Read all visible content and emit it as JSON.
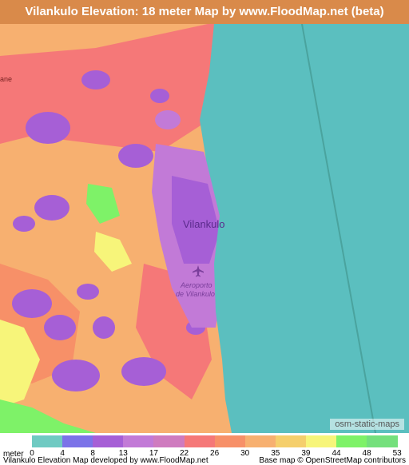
{
  "title": "Vilankulo Elevation: 18 meter Map by www.FloodMap.net (beta)",
  "map": {
    "city_label": "Vilankulo",
    "airport_label_line1": "Aeroporto",
    "airport_label_line2": "de Vilankulo",
    "edge_label": "ane",
    "attribution_badge": "osm-static-maps",
    "airport_icon": "airplane-icon",
    "sea_color": "#5bbfbf"
  },
  "legend": {
    "unit": "meter",
    "ticks": [
      "0",
      "4",
      "8",
      "13",
      "17",
      "22",
      "26",
      "30",
      "35",
      "39",
      "44",
      "48",
      "53"
    ],
    "colors": [
      "#6fcac2",
      "#7b73e8",
      "#a65fd6",
      "#c27ad7",
      "#cf7bbf",
      "#f57878",
      "#f79068",
      "#f7b070",
      "#f5cf6c",
      "#f7f57a",
      "#7ef268",
      "#74e07c"
    ]
  },
  "footer": {
    "left": "Vilankulo Elevation Map developed by www.FloodMap.net",
    "right": "Base map © OpenStreetMap contributors"
  }
}
